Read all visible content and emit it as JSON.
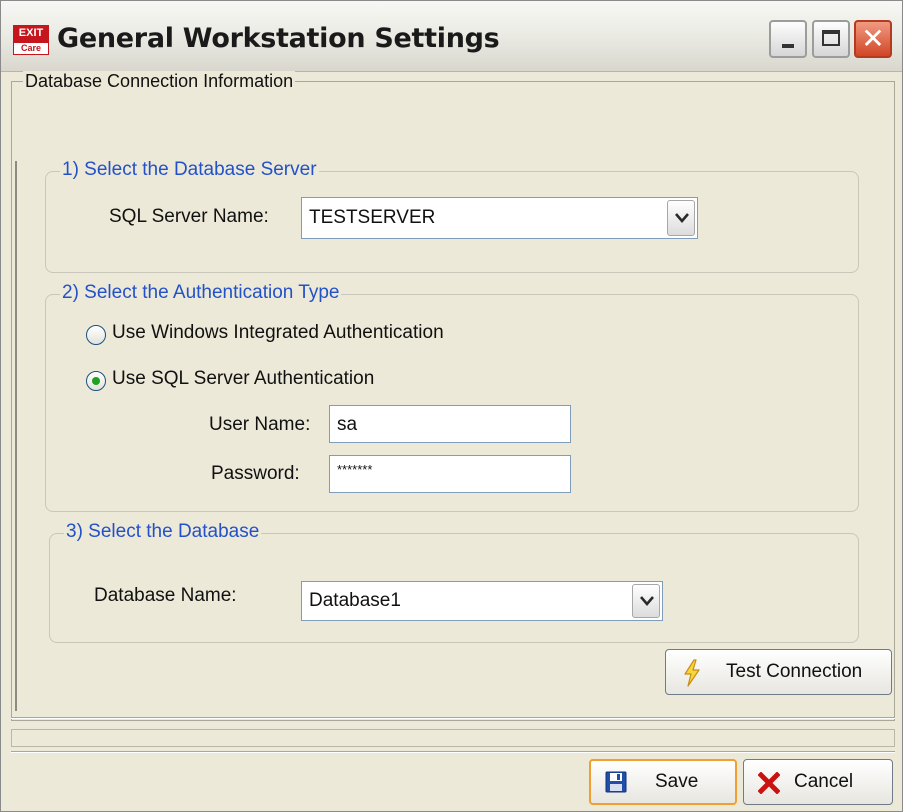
{
  "window": {
    "title": "General Workstation Settings",
    "app_icon_top": "EXIT",
    "app_icon_bottom": "Care"
  },
  "main_group": {
    "legend": "Database Connection Information"
  },
  "server_group": {
    "legend": "1) Select the Database Server",
    "label": "SQL Server Name:",
    "value": "TESTSERVER"
  },
  "auth_group": {
    "legend": "2) Select the Authentication Type",
    "options": [
      {
        "label": "Use Windows Integrated Authentication",
        "selected": false
      },
      {
        "label": "Use SQL Server Authentication",
        "selected": true
      }
    ],
    "user_label": "User Name:",
    "user_value": "sa",
    "password_label": "Password:",
    "password_value": "*******"
  },
  "database_group": {
    "legend": "3) Select the Database",
    "label": "Database Name:",
    "value": "Database1"
  },
  "buttons": {
    "test_connection": "Test Connection",
    "save": "Save",
    "cancel": "Cancel"
  },
  "icons": {
    "test_connection": "lightning-icon",
    "save": "floppy-disk-icon",
    "cancel": "x-icon"
  }
}
